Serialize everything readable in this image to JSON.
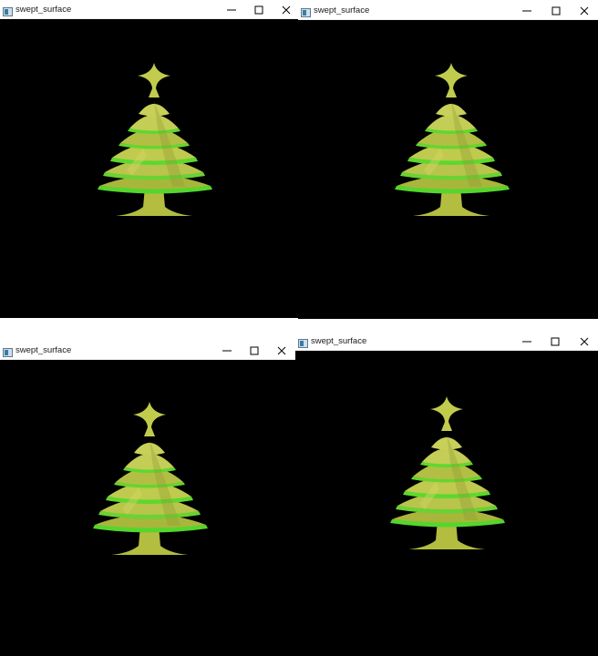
{
  "windows": [
    {
      "id": "top-left",
      "title": "swept_surface"
    },
    {
      "id": "top-right",
      "title": "swept_surface"
    },
    {
      "id": "bottom-left",
      "title": "swept_surface"
    },
    {
      "id": "bottom-right",
      "title": "swept_surface"
    }
  ],
  "colors": {
    "window_background": "#000000",
    "titlebar": "#ffffff",
    "tree_yellow": "#b8c44a",
    "tree_green": "#4ee02a",
    "tree_shadow": "#7f8e2c"
  },
  "icons": {
    "app": "app-window-icon",
    "minimize": "minimize-icon",
    "maximize": "maximize-icon",
    "close": "close-icon"
  }
}
